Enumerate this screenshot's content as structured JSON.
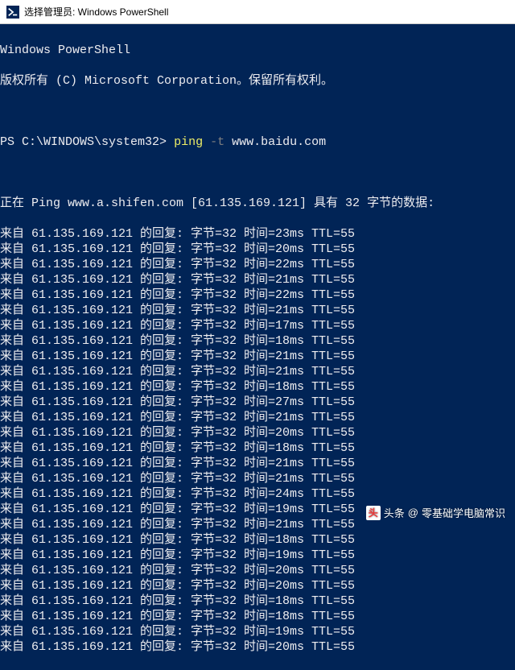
{
  "title": "选择管理员: Windows PowerShell",
  "header": {
    "line1": "Windows PowerShell",
    "line2": "版权所有 (C) Microsoft Corporation。保留所有权利。"
  },
  "prompt": {
    "ps": "PS ",
    "path": "C:\\WINDOWS\\system32>",
    "cmd": "ping ",
    "flag": "-t ",
    "target": "www.baidu.com"
  },
  "ping_header": "正在 Ping www.a.shifen.com [61.135.169.121] 具有 32 字节的数据:",
  "reply": {
    "prefix": "来自 ",
    "ip": "61.135.169.121",
    "mid": " 的回复: 字节=",
    "bytes": "32",
    "time_lbl": " 时间=",
    "ttl_lbl": " TTL=",
    "ttl": "55"
  },
  "times_ms": [
    23,
    20,
    22,
    21,
    22,
    21,
    17,
    18,
    21,
    21,
    18,
    27,
    21,
    20,
    18,
    21,
    21,
    24,
    19,
    21,
    18,
    19,
    20,
    20,
    18,
    18,
    19,
    20
  ],
  "watermark": {
    "prefix": "头条",
    "at": "@",
    "name": "零基础学电脑常识"
  }
}
